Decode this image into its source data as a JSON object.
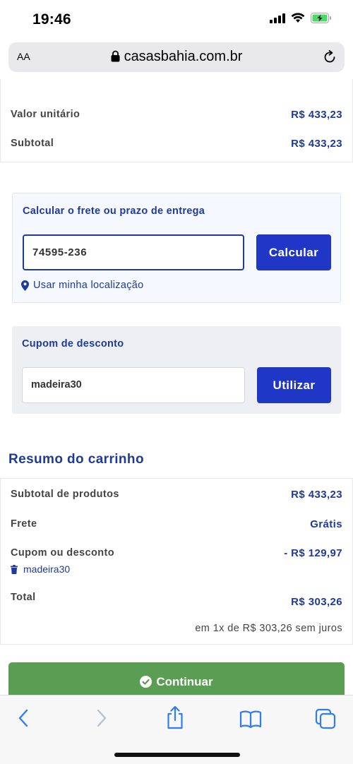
{
  "status_bar": {
    "time": "19:46"
  },
  "browser": {
    "text_size_label": "AA",
    "url": "casasbahia.com.br"
  },
  "product": {
    "unit_value_label": "Valor unitário",
    "unit_value": "R$ 433,23",
    "subtotal_label": "Subtotal",
    "subtotal": "R$ 433,23"
  },
  "shipping": {
    "title": "Calcular o frete ou prazo de entrega",
    "zip_value": "74595-236",
    "calculate_label": "Calcular",
    "location_label": "Usar minha localização"
  },
  "coupon": {
    "title": "Cupom de desconto",
    "code_value": "madeira30",
    "apply_label": "Utilizar"
  },
  "summary": {
    "title": "Resumo do carrinho",
    "products_subtotal_label": "Subtotal de produtos",
    "products_subtotal": "R$ 433,23",
    "shipping_label": "Frete",
    "shipping_value": "Grátis",
    "discount_label": "Cupom ou desconto",
    "discount_value": "- R$ 129,97",
    "applied_coupon": "madeira30",
    "total_label": "Total",
    "total_value": "R$ 303,26",
    "installments": "em 1x de R$ 303,26 sem juros"
  },
  "continue_label": "Continuar",
  "colors": {
    "brand_blue": "#1d3a9c",
    "button_blue": "#1f36c6",
    "continue_green": "#5a9e54",
    "ios_blue": "#2f7cf6"
  },
  "icons": [
    "signal-icon",
    "wifi-icon",
    "battery-icon",
    "lock-icon",
    "reload-icon",
    "location-pin-icon",
    "trash-icon",
    "check-circle-icon",
    "back-icon",
    "forward-icon",
    "share-icon",
    "bookmarks-icon",
    "tabs-icon"
  ]
}
